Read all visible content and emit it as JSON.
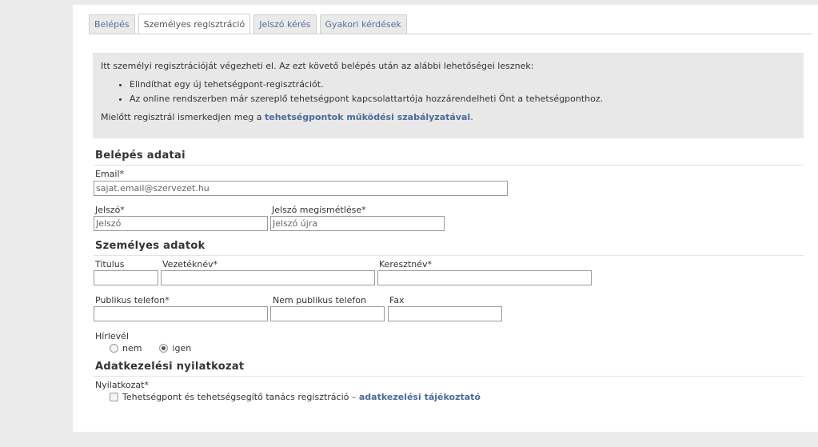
{
  "tabs": [
    {
      "label": "Belépés"
    },
    {
      "label": "Személyes regisztráció",
      "active": true
    },
    {
      "label": "Jelszó kérés"
    },
    {
      "label": "Gyakori kérdések"
    }
  ],
  "info": {
    "intro": "Itt személyi regisztrációját végezheti el. Az ezt követő belépés után az alábbi lehetőségei lesznek:",
    "items": [
      "Elindíthat egy új tehetségpont-regisztrációt.",
      "Az online rendszerben már szereplő tehetségpont kapcsolattartója hozzárendelheti Önt a tehetségponthoz."
    ],
    "rules_prefix": "Mielőtt regisztrál ismerkedjen meg a ",
    "rules_link": "tehetségpontok működési szabályzatával",
    "rules_suffix": "."
  },
  "login_section": {
    "title": "Belépés adatai",
    "email_label": "Email*",
    "email_placeholder": "sajat.email@szervezet.hu",
    "password_label": "Jelszó*",
    "password_placeholder": "Jelszó",
    "password_repeat_label": "Jelszó megismétlése*",
    "password_repeat_placeholder": "Jelszó újra"
  },
  "personal_section": {
    "title": "Személyes adatok",
    "title_label": "Titulus",
    "lastname_label": "Vezetéknév*",
    "firstname_label": "Keresztnév*",
    "public_phone_label": "Publikus telefon*",
    "private_phone_label": "Nem publikus telefon",
    "fax_label": "Fax",
    "newsletter_label": "Hírlevél",
    "newsletter_options": [
      {
        "label": "nem",
        "checked": false
      },
      {
        "label": "igen",
        "checked": true
      }
    ]
  },
  "privacy_section": {
    "title": "Adatkezelési nyilatkozat",
    "declaration_label": "Nyilatkozat*",
    "checkbox_text": "Tehetségpont és tehetségsegítő tanács regisztráció – ",
    "checkbox_link": "adatkezelési tájékoztató"
  }
}
